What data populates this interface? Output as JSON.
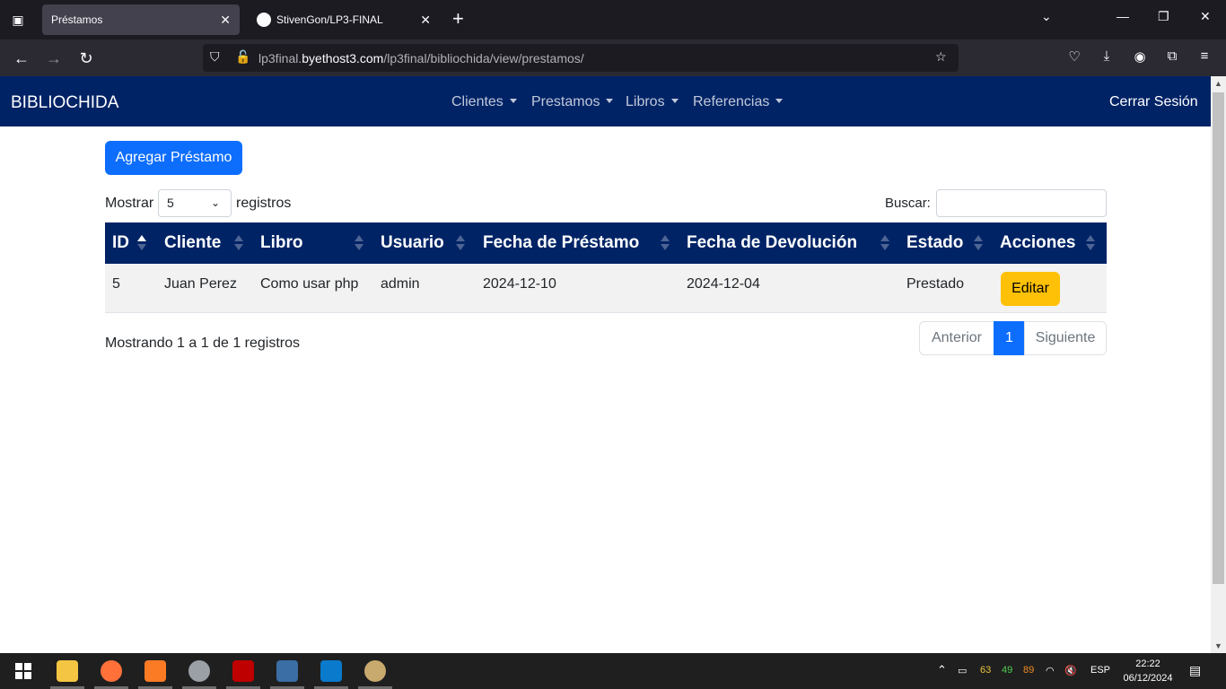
{
  "browser": {
    "tabs": [
      {
        "title": "Préstamos",
        "active": true
      },
      {
        "title": "StivenGon/LP3-FINAL",
        "active": false
      }
    ],
    "url_prefix": "lp3final.",
    "url_domain": "byethost3.com",
    "url_path": "/lp3final/bibliochida/view/prestamos/"
  },
  "app": {
    "brand": "BIBLIOCHIDA",
    "menu": [
      "Clientes",
      "Prestamos",
      "Libros",
      "Referencias"
    ],
    "logout": "Cerrar Sesión"
  },
  "toolbar": {
    "add_button": "Agregar Préstamo",
    "show_label": "Mostrar",
    "page_size": "5",
    "records_label": "registros",
    "search_label": "Buscar:",
    "search_value": ""
  },
  "table": {
    "columns": [
      "ID",
      "Cliente",
      "Libro",
      "Usuario",
      "Fecha de Préstamo",
      "Fecha de Devolución",
      "Estado",
      "Acciones"
    ],
    "sorted_column": "ID",
    "sort_direction": "asc",
    "rows": [
      {
        "id": "5",
        "cliente": "Juan Perez",
        "libro": "Como usar php",
        "usuario": "admin",
        "fecha_prestamo": "2024-12-10",
        "fecha_devolucion": "2024-12-04",
        "estado": "Prestado",
        "accion": "Editar"
      }
    ]
  },
  "footer": {
    "info": "Mostrando 1 a 1 de 1 registros",
    "prev": "Anterior",
    "current_page": "1",
    "next": "Siguiente"
  },
  "taskbar": {
    "tray_numbers": [
      "63",
      "49",
      "89"
    ],
    "language": "ESP",
    "time": "22:22",
    "date": "06/12/2024"
  },
  "colors": {
    "navbar": "#002366",
    "primary": "#0d6efd",
    "warning": "#ffc107"
  }
}
